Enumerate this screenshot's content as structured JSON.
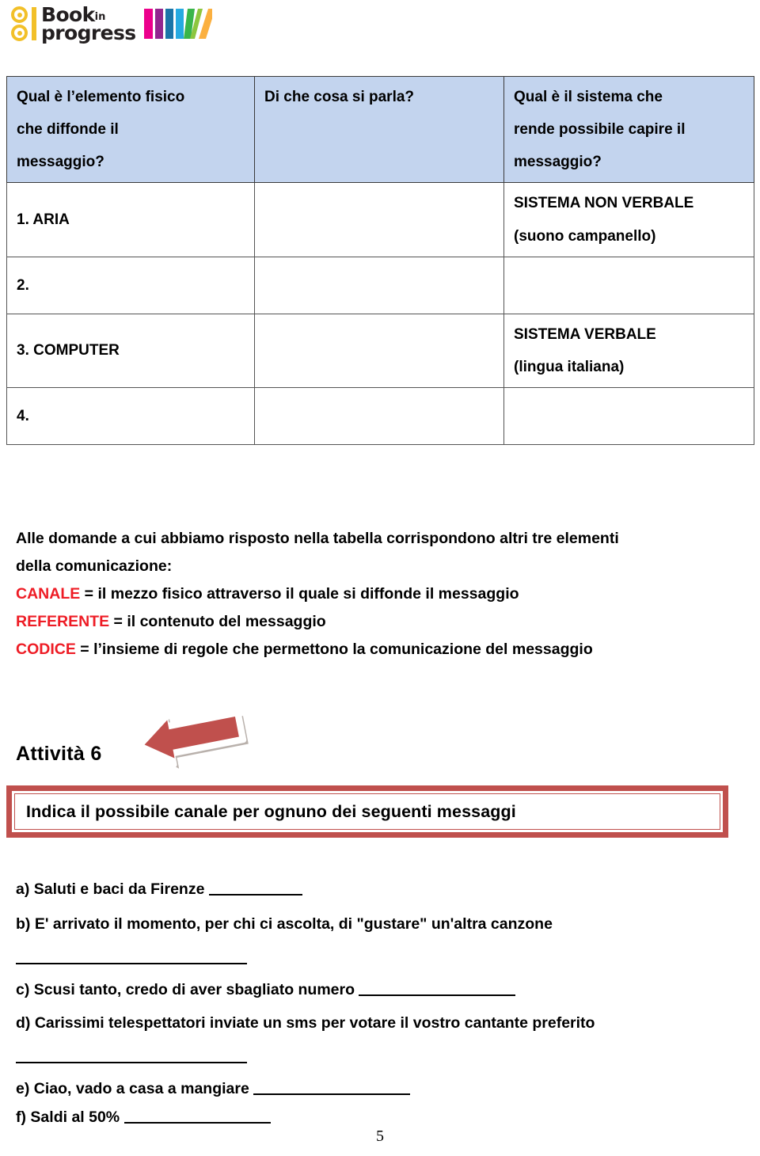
{
  "logo": {
    "brand_line1": "Book",
    "brand_sup": "in",
    "brand_line2": "progress",
    "mark_color": "#f2c029",
    "book_colors": [
      "#ec008c",
      "#92278f",
      "#1b75a8",
      "#27aae1",
      "#39b54a",
      "#8dc63f",
      "#fbb040"
    ]
  },
  "table": {
    "headers": [
      "Qual è l’elemento fisico che diffonde il messaggio?",
      "Di che cosa si parla?",
      "Qual è il sistema che rende possibile capire il messaggio?"
    ],
    "header_lines": [
      [
        "Qual è l’elemento fisico",
        "che diffonde il",
        "messaggio?"
      ],
      [
        "Di che cosa si parla?"
      ],
      [
        "Qual è il sistema che",
        "rende possibile capire il",
        "messaggio?"
      ]
    ],
    "header_bg": "#c3d4ee",
    "rows": [
      {
        "col1": "1. ARIA",
        "col2": "",
        "col3_line1": "SISTEMA NON VERBALE",
        "col3_line2": "(suono campanello)"
      },
      {
        "col1": "2.",
        "col2": "",
        "col3_line1": "",
        "col3_line2": ""
      },
      {
        "col1": "3. COMPUTER",
        "col2": "",
        "col3_line1": "SISTEMA VERBALE",
        "col3_line2": "(lingua italiana)"
      },
      {
        "col1": "4.",
        "col2": "",
        "col3_line1": "",
        "col3_line2": ""
      }
    ]
  },
  "intro": {
    "line1": "Alle domande a cui abbiamo risposto nella tabella corrispondono altri  tre elementi",
    "line2": "della comunicazione:"
  },
  "definitions": [
    {
      "term": "CANALE",
      "definition": "= il mezzo fisico attraverso il quale si diffonde il messaggio"
    },
    {
      "term": "REFERENTE",
      "definition": "= il contenuto del messaggio"
    },
    {
      "term": "CODICE",
      "definition": "= l’insieme di regole che permettono la comunicazione del messaggio"
    }
  ],
  "keyword_color": "#ee1c25",
  "activity": {
    "label": "Attività 6",
    "arrow_color": "#c0504d",
    "box_border_color": "#c0504d",
    "instruction": "Indica il possibile canale per ognuno dei seguenti messaggi"
  },
  "exercises": [
    {
      "marker": "a)",
      "text": "Saluti e baci da Firenze",
      "blank": "inline",
      "blank_width": 118
    },
    {
      "marker": "b)",
      "text": "E' arrivato il momento, per chi ci ascolta, di \"gustare\" un'altra canzone",
      "blank": "below",
      "blank_width": 292
    },
    {
      "marker": "c)",
      "text": "Scusi tanto, credo di aver sbagliato numero",
      "blank": "inline",
      "blank_width": 198
    },
    {
      "marker": "d)",
      "text": "Carissimi telespettatori inviate un sms per votare il vostro cantante preferito",
      "blank": "below",
      "blank_width": 292
    },
    {
      "marker": "e)",
      "text": "Ciao, vado a casa a mangiare",
      "blank": "inline",
      "blank_width": 198
    },
    {
      "marker": "f)",
      "text": "Saldi al 50%",
      "blank": "inline",
      "blank_width": 185
    }
  ],
  "page_number": "5"
}
